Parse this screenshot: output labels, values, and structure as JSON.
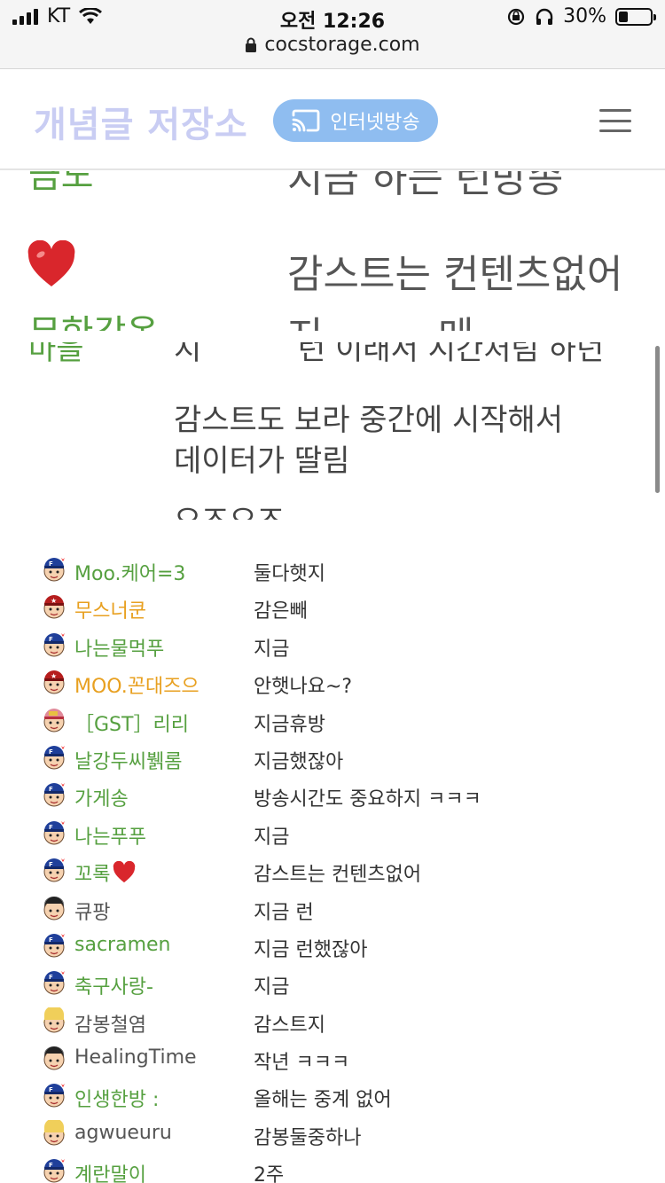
{
  "status_bar": {
    "carrier": "KT",
    "time": "오전 12:26",
    "battery": "30%",
    "battery_level": 0.3
  },
  "browser": {
    "url": "cocstorage.com"
  },
  "site": {
    "logo": "개념글 저장소",
    "broadcast_label": "인터넷방송"
  },
  "snippet1": {
    "cut_top_left": "금도",
    "cut_top_right": "지금 하는 런방송",
    "message": "감스트는 컨텐츠없어",
    "cut_bottom_left": "무한감옹",
    "cut_bottom_mid": "지",
    "cut_bottom_right": "메"
  },
  "snippet2": {
    "cut_top_left": "마을",
    "cut_top_mid": "지",
    "cut_top_right": "런 이래서 시간처럼 하던",
    "line1": "감스트도 보라 중간에 시작해서",
    "line2": "데이터가 딸림",
    "cut_bottom": "오즈오즈"
  },
  "colors": {
    "green": "#56a040",
    "orange": "#e8a020",
    "gray": "#555555"
  },
  "chat": [
    {
      "nick": "Moo.케어=3",
      "message": "둘다햇지",
      "color": "#56a040",
      "avatar": "blue-cap",
      "heart": false
    },
    {
      "nick": "무스너쿤",
      "message": "감은빼",
      "color": "#e8a020",
      "avatar": "red-cap",
      "heart": false
    },
    {
      "nick": "나는물먹푸",
      "message": "지금",
      "color": "#56a040",
      "avatar": "blue-cap",
      "heart": false
    },
    {
      "nick": "MOO.꼰대즈으",
      "message": "안햇나요~?",
      "color": "#e8a020",
      "avatar": "red-cap",
      "heart": false
    },
    {
      "nick": "［GST］리리",
      "message": "지금휴방",
      "color": "#56a040",
      "avatar": "pink-cap",
      "heart": false
    },
    {
      "nick": "날강두씨뷁롬",
      "message": "지금했잖아",
      "color": "#56a040",
      "avatar": "blue-cap",
      "heart": false
    },
    {
      "nick": "가게송",
      "message": "방송시간도 중요하지 ㅋㅋㅋ",
      "color": "#56a040",
      "avatar": "blue-cap",
      "heart": false
    },
    {
      "nick": "나는푸푸",
      "message": "지금",
      "color": "#56a040",
      "avatar": "blue-cap",
      "heart": false
    },
    {
      "nick": "꼬록",
      "message": "감스트는 컨텐츠없어",
      "color": "#56a040",
      "avatar": "blue-cap",
      "heart": true
    },
    {
      "nick": "큐팡",
      "message": "지금 런",
      "color": "#555555",
      "avatar": "plain",
      "heart": false
    },
    {
      "nick": "sacramen",
      "message": "지금 런했잖아",
      "color": "#56a040",
      "avatar": "blue-cap",
      "heart": false
    },
    {
      "nick": "축구사랑-",
      "message": "지금",
      "color": "#56a040",
      "avatar": "blue-cap",
      "heart": false
    },
    {
      "nick": "감봉철염",
      "message": "감스트지",
      "color": "#555555",
      "avatar": "blonde",
      "heart": false
    },
    {
      "nick": "HealingTime",
      "message": "작년 ㅋㅋㅋ",
      "color": "#555555",
      "avatar": "plain",
      "heart": false
    },
    {
      "nick": "인생한방 :",
      "message": "올해는 중계 없어",
      "color": "#56a040",
      "avatar": "blue-cap",
      "heart": false
    },
    {
      "nick": "agwueuru",
      "message": "감봉둘중하나",
      "color": "#555555",
      "avatar": "blonde",
      "heart": false
    },
    {
      "nick": "계란말이",
      "message": "2주",
      "color": "#56a040",
      "avatar": "blue-cap",
      "heart": false
    }
  ]
}
